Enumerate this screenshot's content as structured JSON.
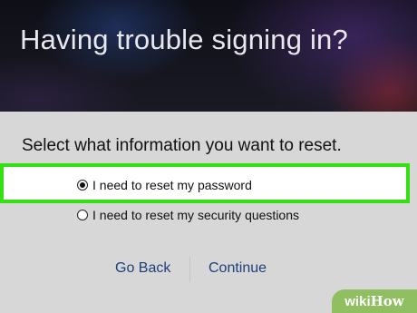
{
  "header": {
    "title": "Having trouble signing in?"
  },
  "prompt": "Select what information you want to reset.",
  "options": [
    {
      "label": "I need to reset my password",
      "selected": true
    },
    {
      "label": "I need to reset my security questions",
      "selected": false
    }
  ],
  "buttons": {
    "back": "Go Back",
    "continue": "Continue"
  },
  "watermark": {
    "part1": "wiki",
    "part2": "How"
  },
  "colors": {
    "highlight": "#35e012",
    "link": "#1f3f7a",
    "watermark_bg": "#8fbf60"
  }
}
